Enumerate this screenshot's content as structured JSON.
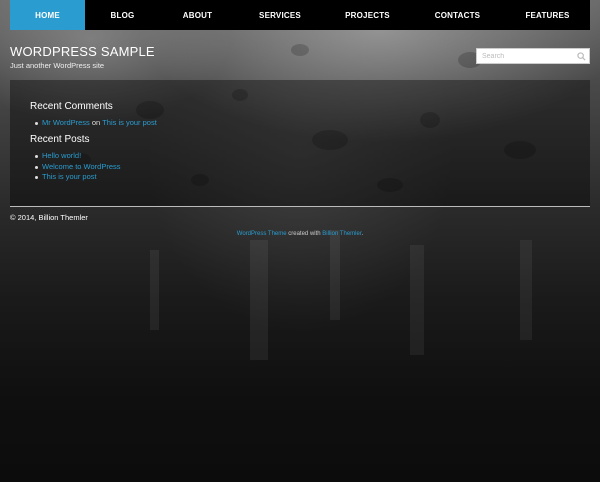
{
  "nav": {
    "items": [
      {
        "label": "HOME",
        "active": true
      },
      {
        "label": "BLOG",
        "active": false
      },
      {
        "label": "ABOUT",
        "active": false
      },
      {
        "label": "SERVICES",
        "active": false
      },
      {
        "label": "PROJECTS",
        "active": false
      },
      {
        "label": "CONTACTS",
        "active": false
      },
      {
        "label": "FEATURES",
        "active": false
      }
    ]
  },
  "header": {
    "title": "WORDPRESS SAMPLE",
    "tagline": "Just another WordPress site",
    "search_placeholder": "Search"
  },
  "widgets": {
    "recent_comments": {
      "title": "Recent Comments",
      "items": [
        {
          "author": "Mr WordPress",
          "connector": "on",
          "post": "This is your post"
        }
      ]
    },
    "recent_posts": {
      "title": "Recent Posts",
      "items": [
        "Hello world!",
        "Welcome to WordPress",
        "This is your post"
      ]
    }
  },
  "footer": {
    "copyright": "© 2014, Billion Themler",
    "credit_link1": "WordPress Theme",
    "credit_middle": " created with ",
    "credit_link2": "Billion Themler",
    "credit_end": "."
  },
  "colors": {
    "accent": "#2a9ccf",
    "nav_bg": "#000000",
    "text": "#dddddd"
  }
}
